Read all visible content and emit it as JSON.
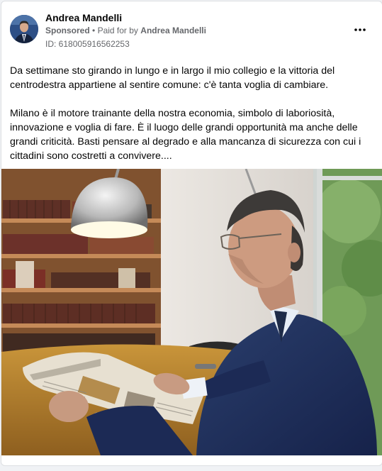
{
  "post": {
    "author": "Andrea Mandelli",
    "sponsored_label": "Sponsored",
    "separator": "•",
    "paid_for_prefix": "Paid for by",
    "paid_for_name": "Andrea Mandelli",
    "ad_id": "ID: 618005916562253",
    "paragraph_1": "Da settimane sto girando in lungo e in largo il mio collegio e la vittoria del centrodestra appartiene al sentire comune: c'è tanta voglia di cambiare.",
    "paragraph_2": "Milano è il motore trainante della nostra economia, simbolo di laboriosità, innovazione e voglia di fare. È il luogo delle grandi opportunità ma anche delle grandi criticità. Basti pensare al degrado e alla mancanza di sicurezza con cui i cittadini sono costretti a convivere...."
  },
  "icons": {
    "more": "more-horizontal-icon"
  },
  "colors": {
    "card_bg": "#ffffff",
    "page_bg": "#f0f2f5",
    "text_primary": "#050505",
    "text_secondary": "#65676b"
  }
}
